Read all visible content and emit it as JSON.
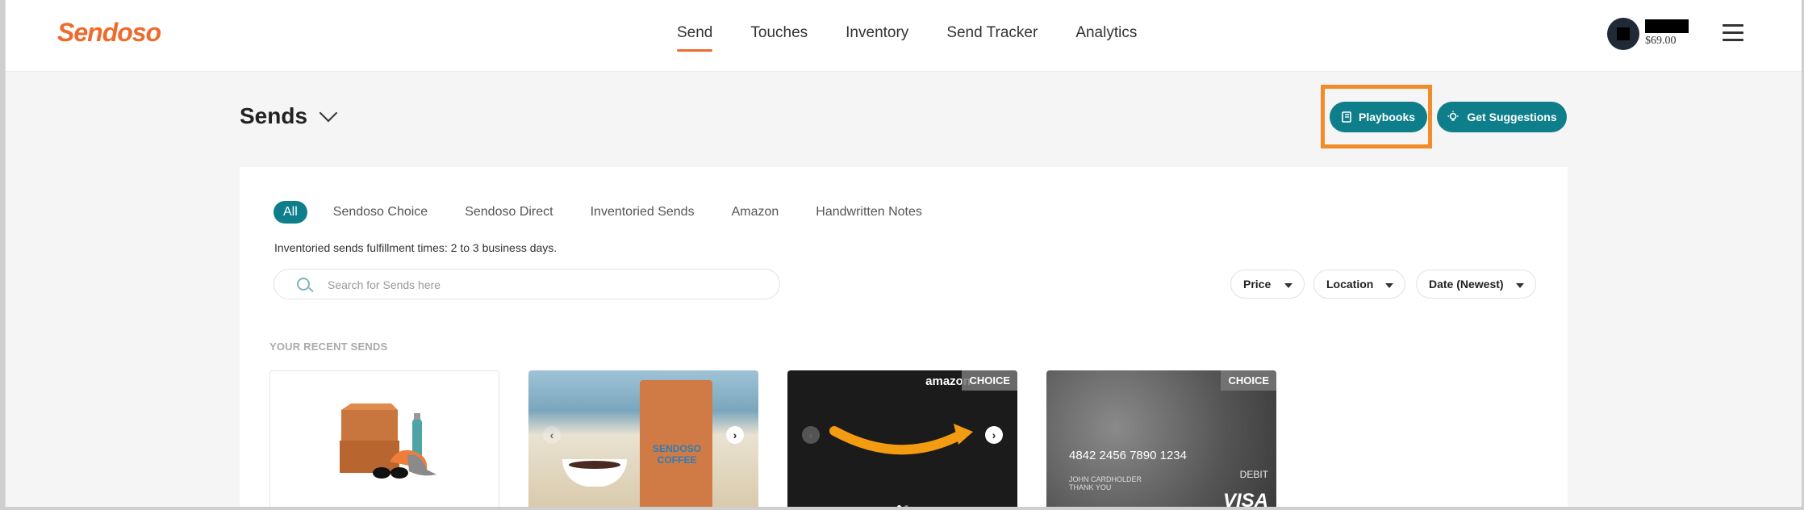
{
  "header": {
    "logo": "Sendoso",
    "nav": [
      "Send",
      "Touches",
      "Inventory",
      "Send Tracker",
      "Analytics"
    ],
    "active_nav": "Send",
    "balance": "$69.00"
  },
  "page": {
    "title": "Sends",
    "playbooks_label": "Playbooks",
    "suggestions_label": "Get Suggestions"
  },
  "tabs": [
    "All",
    "Sendoso Choice",
    "Sendoso Direct",
    "Inventoried Sends",
    "Amazon",
    "Handwritten Notes"
  ],
  "info_text": "Inventoried sends fulfillment times: 2 to 3 business days.",
  "search": {
    "placeholder": "Search for Sends here"
  },
  "filters": {
    "price": "Price",
    "location": "Location",
    "date": "Date (Newest)"
  },
  "recent": {
    "label": "YOUR RECENT SENDS",
    "badge": "CHOICE",
    "amazon_text": "amazon",
    "coffee_label": "SENDOSO COFFEE",
    "card_number": "4842 2456 7890 1234",
    "card_holder": "JOHN CARDHOLDER",
    "card_thanks": "THANK YOU",
    "card_debit": "DEBIT",
    "card_brand": "VISA"
  },
  "colors": {
    "brand": "#ee6b2d",
    "accent": "#0e7f8a",
    "highlight": "#f28c28"
  }
}
